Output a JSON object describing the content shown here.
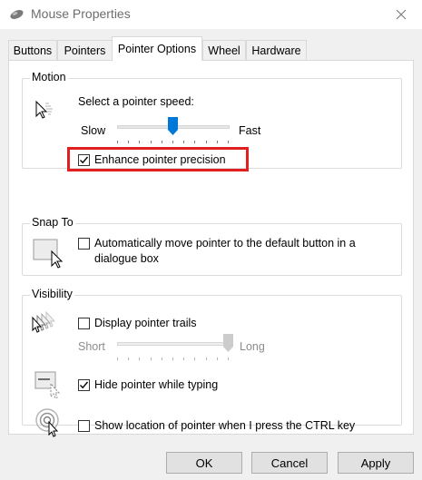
{
  "window": {
    "title": "Mouse Properties",
    "close_glyph": "✕"
  },
  "tabs": [
    {
      "label": "Buttons",
      "active": false
    },
    {
      "label": "Pointers",
      "active": false
    },
    {
      "label": "Pointer Options",
      "active": true
    },
    {
      "label": "Wheel",
      "active": false
    },
    {
      "label": "Hardware",
      "active": false
    }
  ],
  "motion": {
    "title": "Motion",
    "speed_label": "Select a pointer speed:",
    "slow_label": "Slow",
    "fast_label": "Fast",
    "speed_value_fraction": 0.5,
    "precision_label": "Enhance pointer precision",
    "precision_checked": true
  },
  "snap_to": {
    "title": "Snap To",
    "auto_move_label_line1": "Automatically move pointer to the default button in a",
    "auto_move_label_line2": "dialogue box",
    "auto_move_checked": false
  },
  "visibility": {
    "title": "Visibility",
    "trails_label": "Display pointer trails",
    "trails_checked": false,
    "short_label": "Short",
    "long_label": "Long",
    "trail_length_fraction": 1.0,
    "hide_label": "Hide pointer while typing",
    "hide_checked": true,
    "ctrl_label": "Show location of pointer when I press the CTRL key",
    "ctrl_checked": false
  },
  "buttons": {
    "ok": "OK",
    "cancel": "Cancel",
    "apply": "Apply"
  },
  "colors": {
    "highlight": "#e02020",
    "slider_thumb": "#0078d7",
    "panel_bg": "#ffffff",
    "dialog_bg": "#f0f0f0"
  }
}
